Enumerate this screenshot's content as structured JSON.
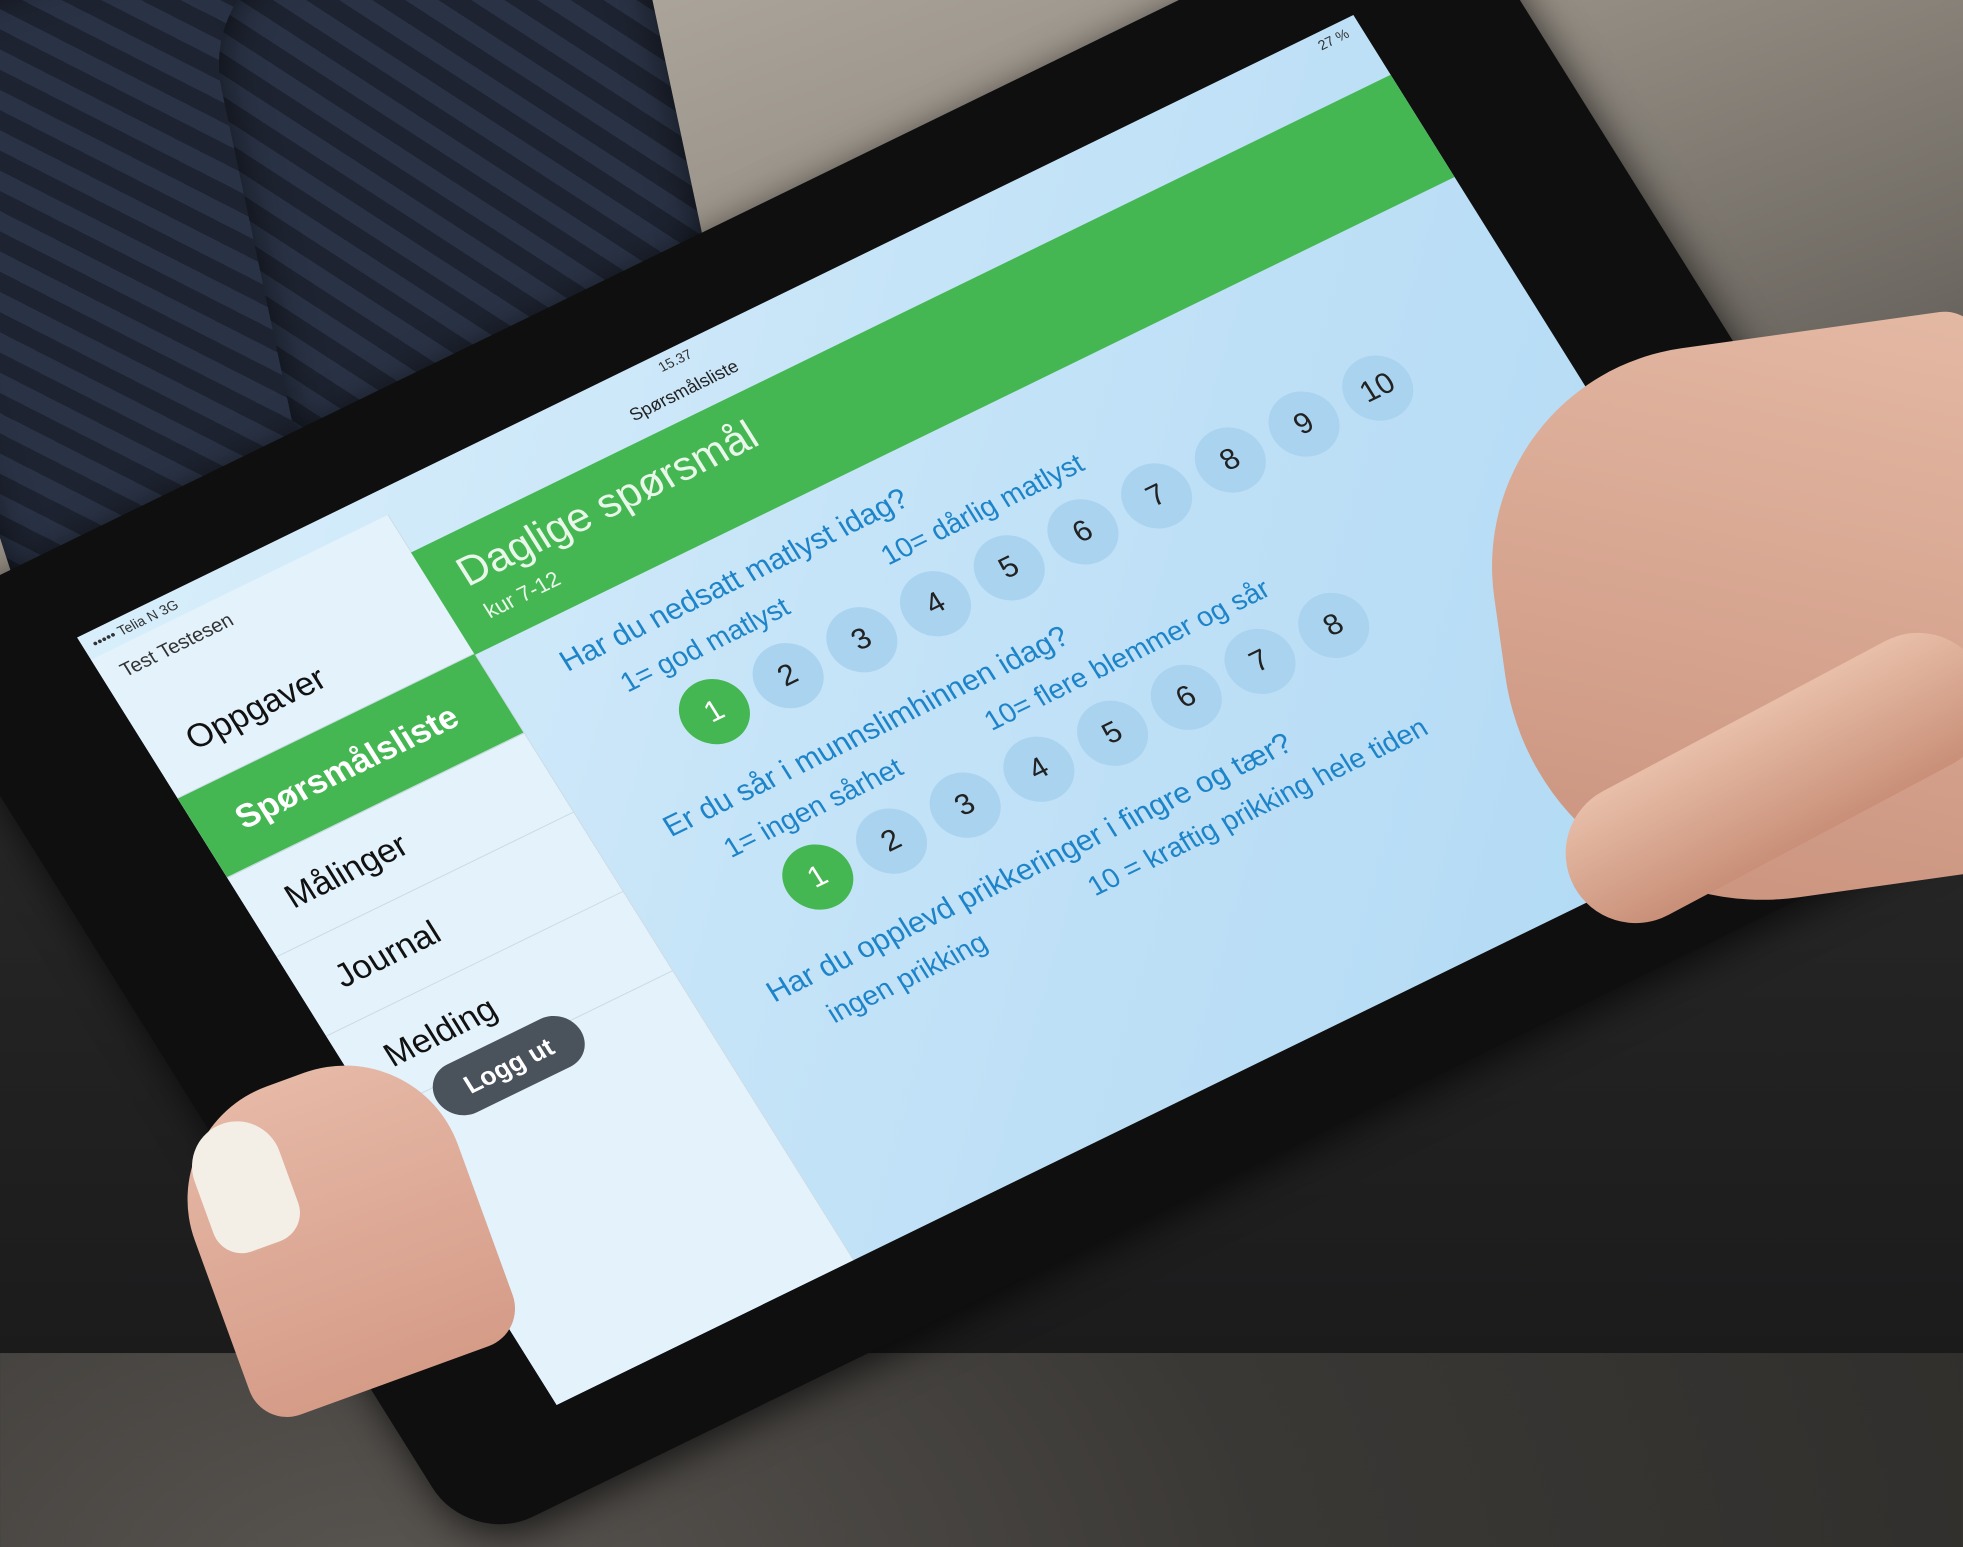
{
  "status": {
    "carrier": "••••• Telia N  3G",
    "time": "15.37",
    "battery": "27 %"
  },
  "nav": {
    "title": "Spørsmålsliste"
  },
  "sidebar": {
    "user": "Test Testesen",
    "items": [
      {
        "label": "Oppgaver",
        "active": false
      },
      {
        "label": "Spørsmålsliste",
        "active": true
      },
      {
        "label": "Målinger",
        "active": false
      },
      {
        "label": "Journal",
        "active": false
      },
      {
        "label": "Melding",
        "active": false
      }
    ],
    "logout": "Logg ut"
  },
  "header": {
    "title": "Daglige spørsmål",
    "subtitle": "kur 7-12"
  },
  "questions": [
    {
      "text": "Har du nedsatt matlyst idag?",
      "low": "1= god matlyst",
      "high": "10= dårlig matlyst",
      "selected": 1,
      "options": [
        "1",
        "2",
        "3",
        "4",
        "5",
        "6",
        "7",
        "8",
        "9",
        "10"
      ]
    },
    {
      "text": "Er du sår i munnslimhinnen idag?",
      "low": "1= ingen sårhet",
      "high": "10= flere blemmer og sår",
      "selected": 1,
      "options": [
        "1",
        "2",
        "3",
        "4",
        "5",
        "6",
        "7",
        "8"
      ]
    },
    {
      "text": "Har du opplevd prikkeringer i fingre og tær?",
      "low": "ingen prikking",
      "high": "10 = kraftig prikking hele tiden",
      "selected": null,
      "options": []
    }
  ],
  "colors": {
    "accent": "#45b752",
    "text_blue": "#1d84c9",
    "circle": "#a9d3ef"
  }
}
